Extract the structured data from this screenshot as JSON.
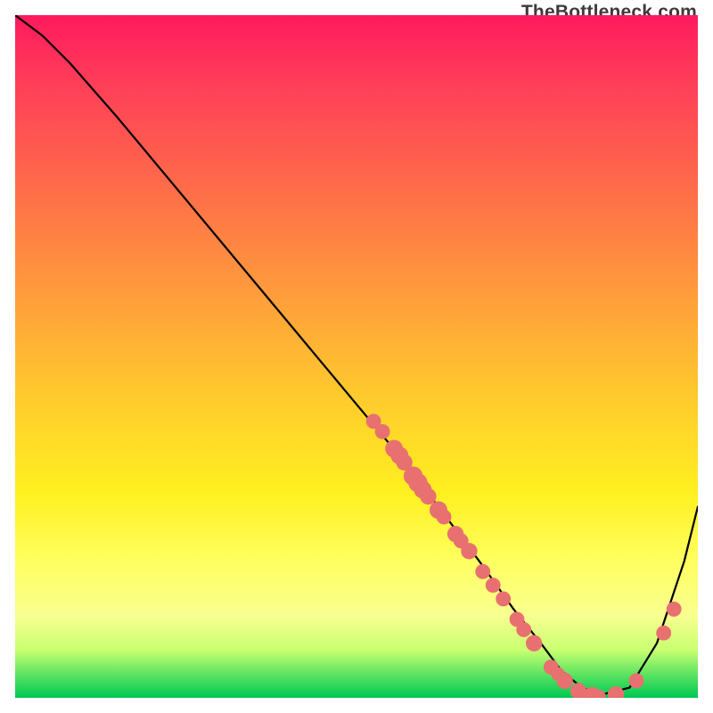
{
  "watermark": "TheBottleneck.com",
  "chart_data": {
    "type": "line",
    "title": "",
    "xlabel": "",
    "ylabel": "",
    "xlim": [
      0,
      100
    ],
    "ylim": [
      0,
      100
    ],
    "series": [
      {
        "name": "curve",
        "x": [
          0,
          4,
          8,
          15,
          25,
          35,
          45,
          55,
          62,
          68,
          73,
          77,
          80,
          83,
          86,
          90,
          94,
          98,
          100
        ],
        "y": [
          100,
          97,
          93,
          85,
          73,
          61,
          49,
          37,
          28,
          20,
          13,
          8,
          4,
          1.5,
          0.5,
          1.5,
          8,
          20,
          28
        ]
      }
    ],
    "markers": [
      {
        "x": 52.5,
        "y": 40.5,
        "r": 1.1
      },
      {
        "x": 53.8,
        "y": 39.0,
        "r": 1.1
      },
      {
        "x": 55.5,
        "y": 36.5,
        "r": 1.3
      },
      {
        "x": 56.3,
        "y": 35.5,
        "r": 1.3
      },
      {
        "x": 57.0,
        "y": 34.5,
        "r": 1.2
      },
      {
        "x": 58.3,
        "y": 32.5,
        "r": 1.4
      },
      {
        "x": 59.0,
        "y": 31.5,
        "r": 1.4
      },
      {
        "x": 59.7,
        "y": 30.5,
        "r": 1.3
      },
      {
        "x": 60.5,
        "y": 29.5,
        "r": 1.2
      },
      {
        "x": 62.0,
        "y": 27.5,
        "r": 1.3
      },
      {
        "x": 62.8,
        "y": 26.5,
        "r": 1.1
      },
      {
        "x": 64.5,
        "y": 24.0,
        "r": 1.2
      },
      {
        "x": 65.3,
        "y": 23.0,
        "r": 1.1
      },
      {
        "x": 66.5,
        "y": 21.5,
        "r": 1.2
      },
      {
        "x": 68.5,
        "y": 18.5,
        "r": 1.1
      },
      {
        "x": 70.0,
        "y": 16.5,
        "r": 1.1
      },
      {
        "x": 71.5,
        "y": 14.5,
        "r": 1.1
      },
      {
        "x": 73.5,
        "y": 11.5,
        "r": 1.1
      },
      {
        "x": 74.5,
        "y": 10.0,
        "r": 1.1
      },
      {
        "x": 76.0,
        "y": 8.0,
        "r": 1.2
      },
      {
        "x": 78.5,
        "y": 4.5,
        "r": 1.1
      },
      {
        "x": 79.5,
        "y": 3.5,
        "r": 1.0
      },
      {
        "x": 80.5,
        "y": 2.5,
        "r": 1.2
      },
      {
        "x": 82.5,
        "y": 1.0,
        "r": 1.2
      },
      {
        "x": 84.5,
        "y": 0.3,
        "r": 1.3
      },
      {
        "x": 85.5,
        "y": 0.2,
        "r": 1.0
      },
      {
        "x": 88.0,
        "y": 0.5,
        "r": 1.2
      },
      {
        "x": 91.0,
        "y": 2.5,
        "r": 1.1
      },
      {
        "x": 95.0,
        "y": 9.5,
        "r": 1.1
      },
      {
        "x": 96.5,
        "y": 13.0,
        "r": 1.1
      }
    ],
    "marker_color": "#e87070"
  }
}
